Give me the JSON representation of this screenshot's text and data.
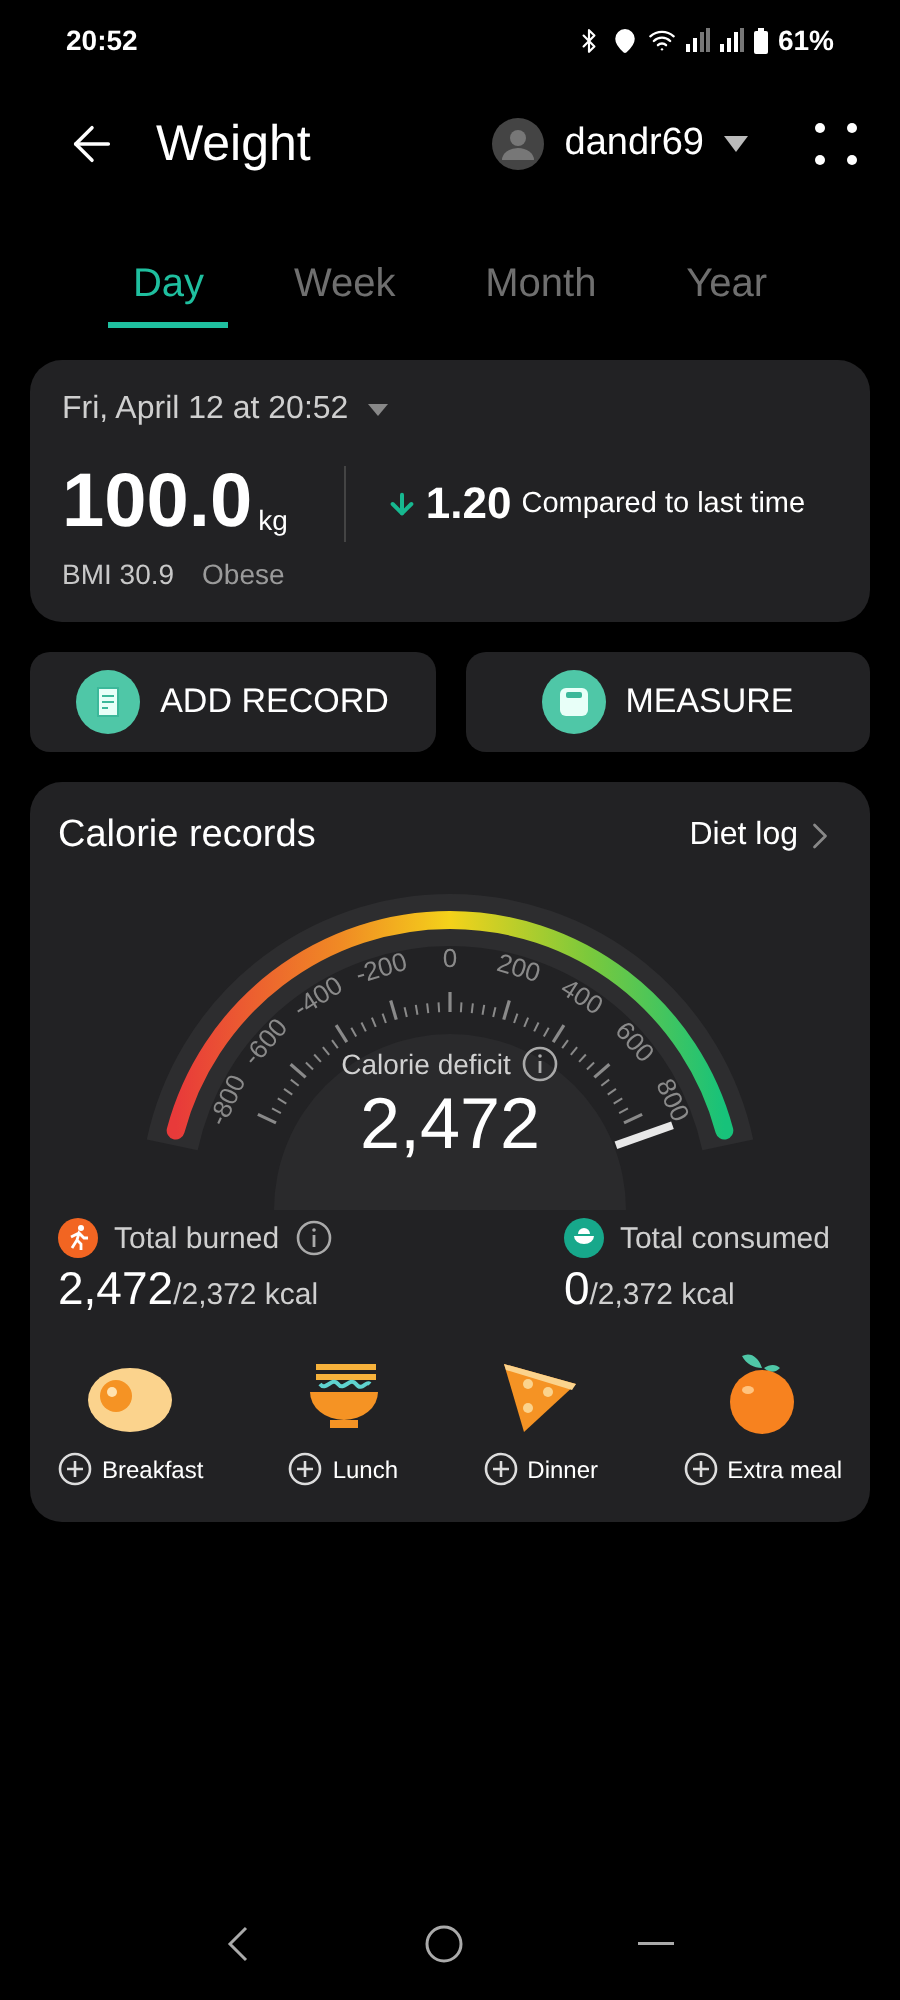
{
  "status_bar": {
    "time": "20:52",
    "battery": "61%"
  },
  "header": {
    "title": "Weight",
    "user": "dandr69"
  },
  "tabs": [
    {
      "label": "Day",
      "selected": true
    },
    {
      "label": "Week",
      "selected": false
    },
    {
      "label": "Month",
      "selected": false
    },
    {
      "label": "Year",
      "selected": false
    }
  ],
  "weight_card": {
    "date": "Fri, April 12 at 20:52",
    "value": "100.0",
    "unit": "kg",
    "change": "1.20",
    "change_label": "Compared to last time",
    "bmi": "BMI 30.9",
    "bmi_category": "Obese"
  },
  "actions": [
    {
      "label": "ADD RECORD",
      "kind": "record"
    },
    {
      "label": "MEASURE",
      "kind": "scale"
    }
  ],
  "calories": {
    "title": "Calorie records",
    "link": "Diet log",
    "gauge": {
      "ticks": [
        "-800",
        "-600",
        "-400",
        "-200",
        "0",
        "200",
        "400",
        "600",
        "800"
      ],
      "label": "Calorie deficit",
      "value": "2,472"
    },
    "totals": [
      {
        "kind": "burned",
        "label": "Total burned",
        "value": "2,472",
        "target": "/2,372 kcal",
        "info": true
      },
      {
        "kind": "consumed",
        "label": "Total consumed",
        "value": "0",
        "target": "/2,372 kcal",
        "info": false
      }
    ],
    "meals": [
      {
        "kind": "egg",
        "label": "Breakfast"
      },
      {
        "kind": "noodles",
        "label": "Lunch"
      },
      {
        "kind": "pizza",
        "label": "Dinner"
      },
      {
        "kind": "orange",
        "label": "Extra meal"
      }
    ]
  }
}
